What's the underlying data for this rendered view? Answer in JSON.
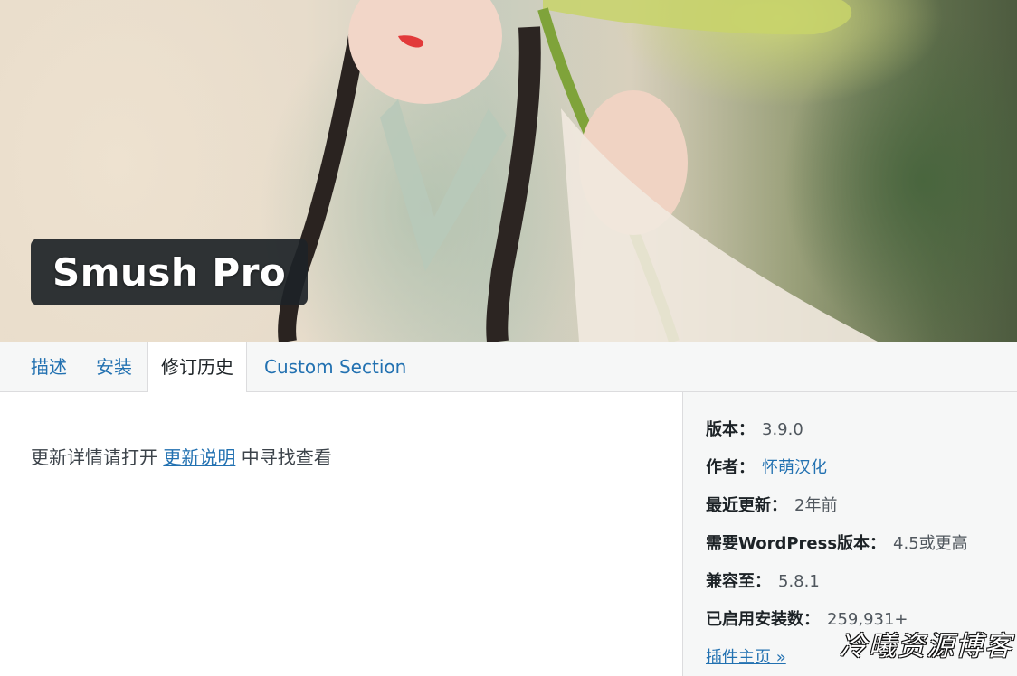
{
  "banner": {
    "title": "Smush Pro"
  },
  "tabs": [
    {
      "label": "描述",
      "active": false
    },
    {
      "label": "安装",
      "active": false
    },
    {
      "label": "修订历史",
      "active": true
    },
    {
      "label": "Custom Section",
      "active": false
    }
  ],
  "main": {
    "text_before": "更新详情请打开",
    "link": "更新说明",
    "text_after": "中寻找查看"
  },
  "meta": {
    "version": {
      "label": "版本：",
      "value": "3.9.0"
    },
    "author": {
      "label": "作者：",
      "value": "怀萌汉化"
    },
    "updated": {
      "label": "最近更新：",
      "value": "2年前"
    },
    "requires": {
      "label": "需要WordPress版本：",
      "value": "4.5或更高"
    },
    "tested": {
      "label": "兼容至：",
      "value": "5.8.1"
    },
    "installs": {
      "label": "已启用安装数：",
      "value": "259,931+"
    },
    "homepage": "插件主页 »"
  },
  "watermark": "冷曦资源博客",
  "colors": {
    "link": "#2271b1",
    "title_bg": "#1d2327",
    "sidebar_bg": "#f6f7f7"
  }
}
